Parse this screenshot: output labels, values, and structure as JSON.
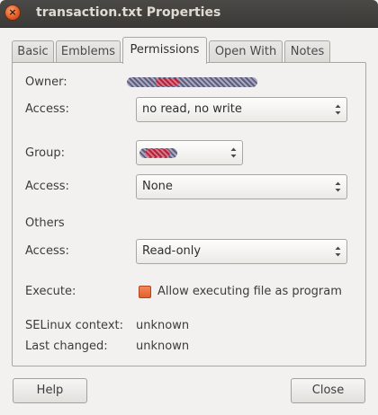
{
  "window": {
    "title": "transaction.txt Properties"
  },
  "tabs": [
    {
      "label": "Basic"
    },
    {
      "label": "Emblems"
    },
    {
      "label": "Permissions"
    },
    {
      "label": "Open With"
    },
    {
      "label": "Notes"
    }
  ],
  "active_tab": "Permissions",
  "owner": {
    "label": "Owner:",
    "value_redacted": true
  },
  "owner_access": {
    "label": "Access:",
    "value": "no read, no write"
  },
  "group": {
    "label": "Group:",
    "value_redacted": true
  },
  "group_access": {
    "label": "Access:",
    "value": "None"
  },
  "others": {
    "heading": "Others",
    "access_label": "Access:",
    "access_value": "Read-only"
  },
  "execute": {
    "label": "Execute:",
    "checkbox_label": "Allow executing file as program",
    "checked": false
  },
  "selinux": {
    "label": "SELinux context:",
    "value": "unknown"
  },
  "last_changed": {
    "label": "Last changed:",
    "value": "unknown"
  },
  "buttons": {
    "help": "Help",
    "close": "Close"
  },
  "colors": {
    "titlebar": "#3c3b37",
    "accent": "#e9632f",
    "background": "#f2f1ef"
  }
}
